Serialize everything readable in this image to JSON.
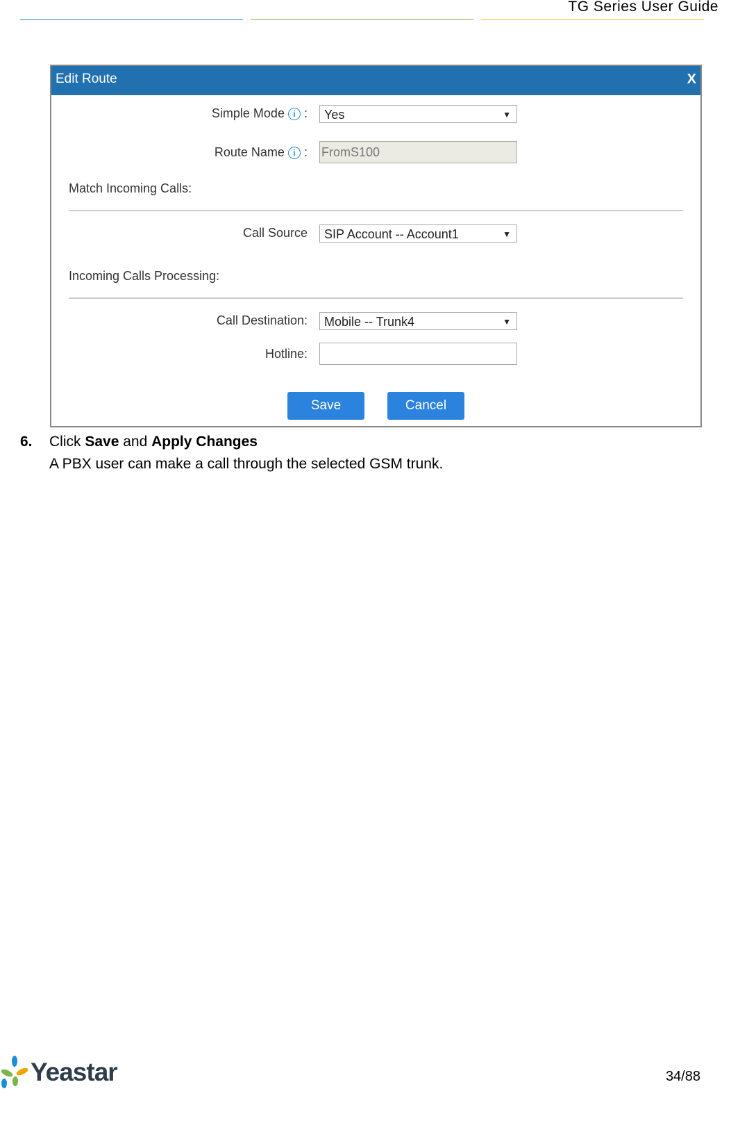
{
  "header": {
    "title": "TG Series User Guide",
    "line_colors": [
      "#1a8fd6",
      "#7ab648",
      "#f0b429"
    ]
  },
  "dialog": {
    "title": "Edit Route",
    "close": "X",
    "simple_mode_label": "Simple Mode",
    "simple_mode_value": "Yes",
    "route_name_label": "Route Name",
    "route_name_value": "FromS100",
    "match_section": "Match Incoming Calls:",
    "call_source_label": "Call Source",
    "call_source_value": "SIP Account -- Account1",
    "processing_section": "Incoming Calls Processing:",
    "call_destination_label": "Call Destination:",
    "call_destination_value": "Mobile -- Trunk4",
    "hotline_label": "Hotline:",
    "hotline_value": "",
    "save": "Save",
    "cancel": "Cancel",
    "colon": ":",
    "info_glyph": "i",
    "arrow": "▼"
  },
  "step": {
    "number": "6.",
    "prefix": "Click ",
    "save": "Save",
    "and": " and ",
    "apply": "Apply Changes",
    "desc": "A PBX user can make a call through the selected GSM trunk."
  },
  "footer": {
    "logo_text": "Yeastar",
    "page": "34/88"
  }
}
